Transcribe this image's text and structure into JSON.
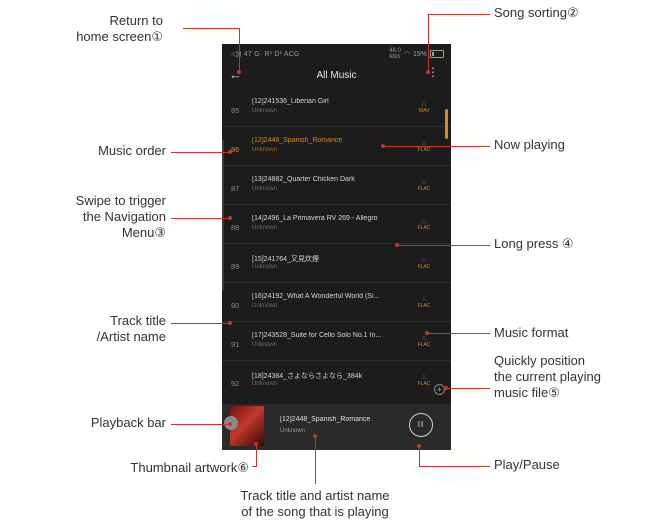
{
  "status_bar": {
    "left": "◁)) 47 G· R¹ D¹ ACG",
    "speed": "48.0",
    "speed_unit": "kb/s",
    "battery": "19%"
  },
  "header": {
    "back_icon": "←",
    "title": "All Music",
    "more_icon": "⋮"
  },
  "tracks": [
    {
      "num": "85",
      "title": "[12]241536_Liberian Girl",
      "artist": "Unknown",
      "format": "WAV"
    },
    {
      "num": "86",
      "title": "[12]2448_Spanish_Romance",
      "artist": "Unknown",
      "format": "FLAC"
    },
    {
      "num": "87",
      "title": "[13]24882_Quarter Chicken Dark",
      "artist": "Unknown",
      "format": "FLAC"
    },
    {
      "num": "88",
      "title": "[14]2496_La Primavera RV 269 - Allegro",
      "artist": "Unknown",
      "format": "FLAC"
    },
    {
      "num": "89",
      "title": "[15]241764_又見炊煙",
      "artist": "Unknown",
      "format": "FLAC"
    },
    {
      "num": "90",
      "title": "[16]24192_What A Wonderful World (Si...",
      "artist": "Unknown",
      "format": "FLAC"
    },
    {
      "num": "91",
      "title": "[17]243528_Suite for Cello Solo No.1 In...",
      "artist": "Unknown",
      "format": "FLAC"
    },
    {
      "num": "92",
      "title": "[18]24384_さよならさよなら_384k",
      "artist": "Unknown",
      "format": "FLAC"
    }
  ],
  "playback": {
    "title": "[12]2448_Spanish_Romance",
    "artist": "Unknown",
    "pause_icon": "II"
  },
  "annotations": {
    "return_home": [
      "Return to",
      "home screen①"
    ],
    "song_sorting": "Song sorting②",
    "music_order": "Music order",
    "now_playing": "Now playing",
    "swipe_nav": [
      "Swipe to trigger",
      "the Navigation",
      "Menu③"
    ],
    "long_press": "Long press ④",
    "track_title": [
      "Track title",
      "/Artist name"
    ],
    "music_format": "Music format",
    "quick_position": [
      "Quickly position",
      "the current playing",
      "music file⑤"
    ],
    "playback_bar": "Playback bar",
    "thumbnail": "Thumbnail artwork⑥",
    "play_pause": "Play/Pause",
    "bottom_caption": [
      "Track title and artist name",
      "of the song that is playing"
    ]
  }
}
